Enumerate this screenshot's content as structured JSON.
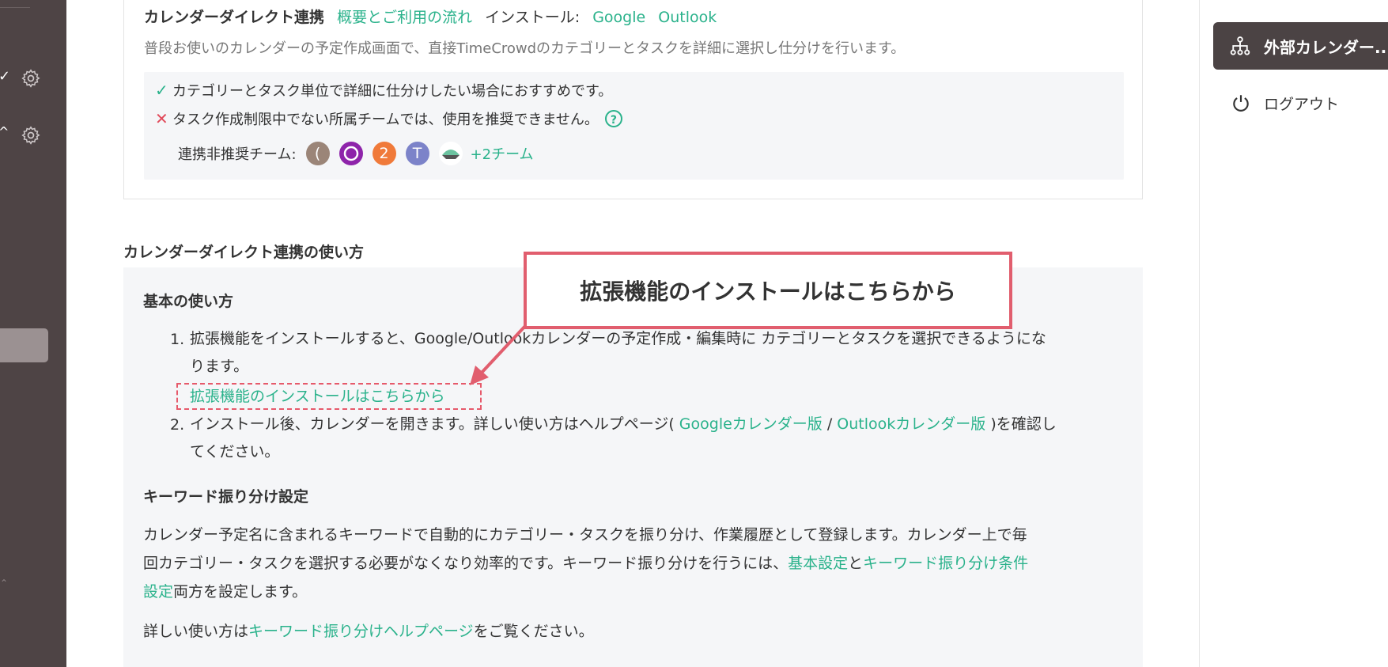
{
  "integration_card": {
    "title": "カレンダーダイレクト連携",
    "overview_link": "概要とご利用の流れ",
    "install_label": "インストール:",
    "install_google": "Google",
    "install_outlook": "Outlook",
    "description": "普段お使いのカレンダーの予定作成画面で、直接TimeCrowdのカテゴリーとタスクを詳細に選択し仕分けを行います。",
    "recommend_text": "カテゴリーとタスク単位で詳細に仕分けしたい場合におすすめです。",
    "not_recommended_text": "タスク作成制限中でない所属チームでは、使用を推奨できません。",
    "help_mark": "?",
    "team_label": "連携非推奨チーム:",
    "team_avatars": [
      {
        "letter": "(",
        "color": "#9b8578"
      },
      {
        "letter": "",
        "color": "#8e24aa"
      },
      {
        "letter": "2",
        "color": "#f07a3a"
      },
      {
        "letter": "T",
        "color": "#7c83c9"
      },
      {
        "letter": "",
        "color": "#ffffff"
      }
    ],
    "more_teams": "+2チーム"
  },
  "usage": {
    "heading": "カレンダーダイレクト連携の使い方",
    "basic_heading": "基本の使い方",
    "step1_num": "1.",
    "step1_line1": "拡張機能をインストールすると、Google/Outlookカレンダーの予定作成・編集時に カテゴリーとタスクを選択できるようにな",
    "step1_line2": "ります。",
    "install_link": "拡張機能のインストールはこちらから",
    "step2_num": "2.",
    "step2_pre": "インストール後、カレンダーを開きます。詳しい使い方はヘルプページ( ",
    "step2_google_link": "Googleカレンダー版",
    "step2_sep": " / ",
    "step2_outlook_link": "Outlookカレンダー版",
    "step2_post": " )を確認し",
    "step2_line2": "てください。",
    "keyword_heading": "キーワード振り分け設定",
    "keyword_p1_line1": "カレンダー予定名に含まれるキーワードで自動的にカテゴリー・タスクを振り分け、作業履歴として登録します。カレンダー上で毎",
    "keyword_p1_line2_pre": "回カテゴリー・タスクを選択する必要がなくなり効率的です。キーワード振り分けを行うには、",
    "basic_settings_link": "基本設定",
    "and_text": "と",
    "keyword_conditions_link_part1": "キーワード振り分け条件",
    "keyword_conditions_link_part2": "設定",
    "keyword_p1_line3_post": "両方を設定します。",
    "detail_pre": "詳しい使い方は",
    "keyword_help_link": "キーワード振り分けヘルプページ",
    "detail_post": "をご覧ください。"
  },
  "callout": {
    "text": "拡張機能のインストールはこちらから"
  },
  "right_panel": {
    "external_calendar_label": "外部カレンダー...",
    "logout_label": "ログアウト"
  },
  "colors": {
    "accent_green": "#2ab28b",
    "sidebar_dark": "#4e4445",
    "callout_red": "#e15e6e"
  },
  "icons": [
    "check-icon",
    "gear-icon",
    "caret-up-icon",
    "sitemap-icon",
    "power-icon",
    "help-icon",
    "check-mark-icon",
    "cross-mark-icon"
  ]
}
